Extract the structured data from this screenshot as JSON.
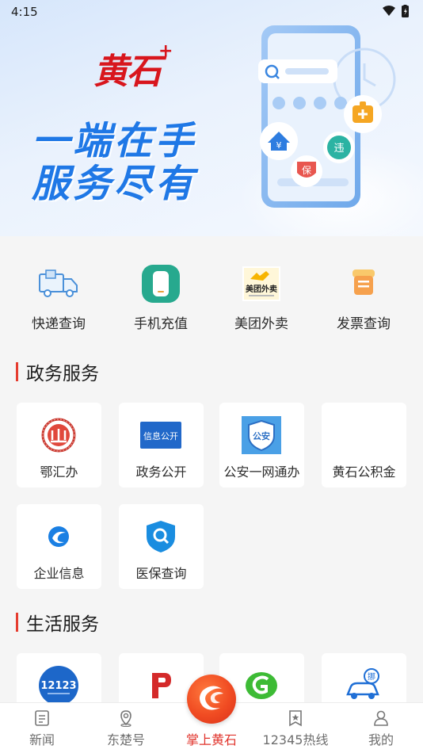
{
  "status_bar": {
    "time": "4:15"
  },
  "banner": {
    "brand": "黄石",
    "brand_plus": "+",
    "slogan_line1": "一端在手",
    "slogan_line2": "服务尽有"
  },
  "shortcuts": [
    {
      "label": "快递查询",
      "icon": "delivery-truck-icon"
    },
    {
      "label": "手机充值",
      "icon": "phone-recharge-icon"
    },
    {
      "label": "美团外卖",
      "icon": "meituan-logo",
      "logo_text": "美团外卖"
    },
    {
      "label": "发票查询",
      "icon": "invoice-icon"
    }
  ],
  "gov_services": {
    "title": "政务服务",
    "items": [
      {
        "label": "鄂汇办",
        "icon": "ehuiban-logo"
      },
      {
        "label": "政务公开",
        "icon": "gov-open-icon",
        "logo_text": "信息公开"
      },
      {
        "label": "公安一网通办",
        "icon": "police-shield-icon",
        "logo_text": "公安"
      },
      {
        "label": "黄石公积金",
        "icon": ""
      },
      {
        "label": "企业信息",
        "icon": "enterprise-icon"
      },
      {
        "label": "医保查询",
        "icon": "medical-insurance-search-icon"
      }
    ]
  },
  "life_services": {
    "title": "生活服务",
    "items": [
      {
        "icon": "traffic-12123-icon",
        "logo_text": "12123"
      },
      {
        "icon": "parking-p-icon"
      },
      {
        "icon": "g-logo-icon"
      },
      {
        "icon": "car-move-icon",
        "logo_text": "挪"
      }
    ]
  },
  "bottom_nav": [
    {
      "label": "新闻",
      "icon": "news-icon",
      "active": false
    },
    {
      "label": "东楚号",
      "icon": "location-pin-icon",
      "active": false
    },
    {
      "label": "掌上黄石",
      "icon": "app-logo-icon",
      "active": true
    },
    {
      "label": "12345热线",
      "icon": "hotline-star-icon",
      "active": false
    },
    {
      "label": "我的",
      "icon": "profile-icon",
      "active": false
    }
  ],
  "colors": {
    "accent_red": "#e0322a",
    "slogan_blue": "#1f78e6",
    "background": "#f5f5f5"
  }
}
